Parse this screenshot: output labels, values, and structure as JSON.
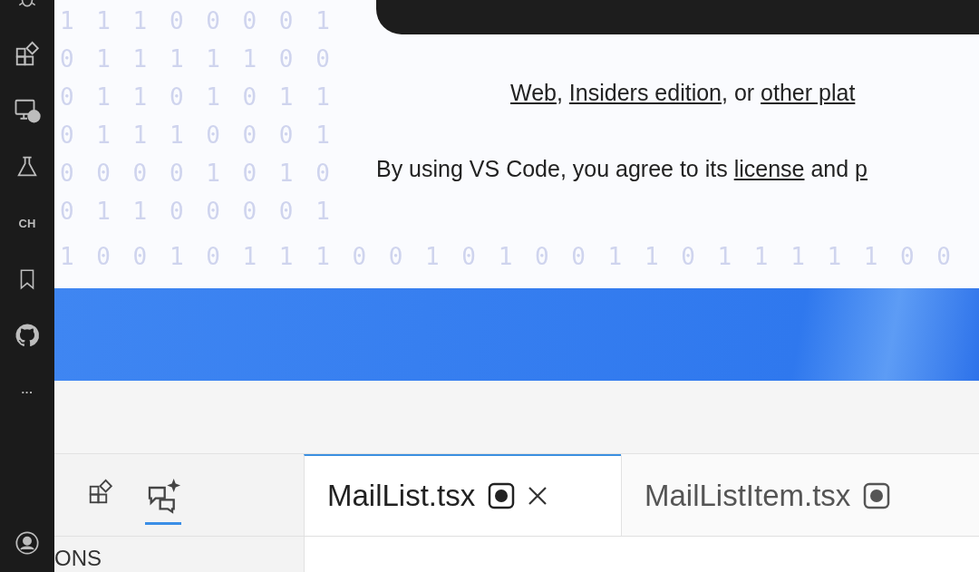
{
  "activity_bar": {
    "items": [
      {
        "kind": "icon"
      },
      {
        "kind": "icon"
      },
      {
        "kind": "icon"
      },
      {
        "kind": "icon"
      },
      {
        "kind": "text",
        "label": "CH"
      },
      {
        "kind": "icon"
      },
      {
        "kind": "icon"
      },
      {
        "kind": "text",
        "label": "···"
      }
    ]
  },
  "binary_rows": [
    "1 1 1 0 0 0 0 1",
    "0 1 1 1 1 1 0 0",
    "0 1 1 0 1 0 1 1",
    "0 1 1 1 0 0 0 1",
    "0 0 0 0 1 0 1 0",
    "0 1 1 0 0 0 0 1"
  ],
  "binary_wide_row": "1 0 0 1 0 1 1 1 0 0 1 0 1 0 0 1 1 0 1 1 1 1 1 0 0",
  "welcome": {
    "lines": [
      [
        {
          "kind": "link",
          "text": "Web"
        },
        {
          "kind": "text",
          "text": ", "
        },
        {
          "kind": "link",
          "text": "Insiders edition"
        },
        {
          "kind": "text",
          "text": ", or "
        },
        {
          "kind": "link",
          "text": "other plat"
        }
      ],
      [
        {
          "kind": "text",
          "text": "By using VS Code, you agree to its "
        },
        {
          "kind": "link",
          "text": "license"
        },
        {
          "kind": "text",
          "text": " and "
        },
        {
          "kind": "link",
          "text": "p"
        }
      ]
    ]
  },
  "panel_icons": [
    {
      "selected": false
    },
    {
      "selected": true
    }
  ],
  "tabs": [
    {
      "label": "MailList.tsx",
      "selected": true,
      "modified": true,
      "closable": true
    },
    {
      "label": "MailListItem.tsx",
      "selected": false,
      "modified": true,
      "closable": false
    }
  ],
  "sidebar_header": "ONS"
}
